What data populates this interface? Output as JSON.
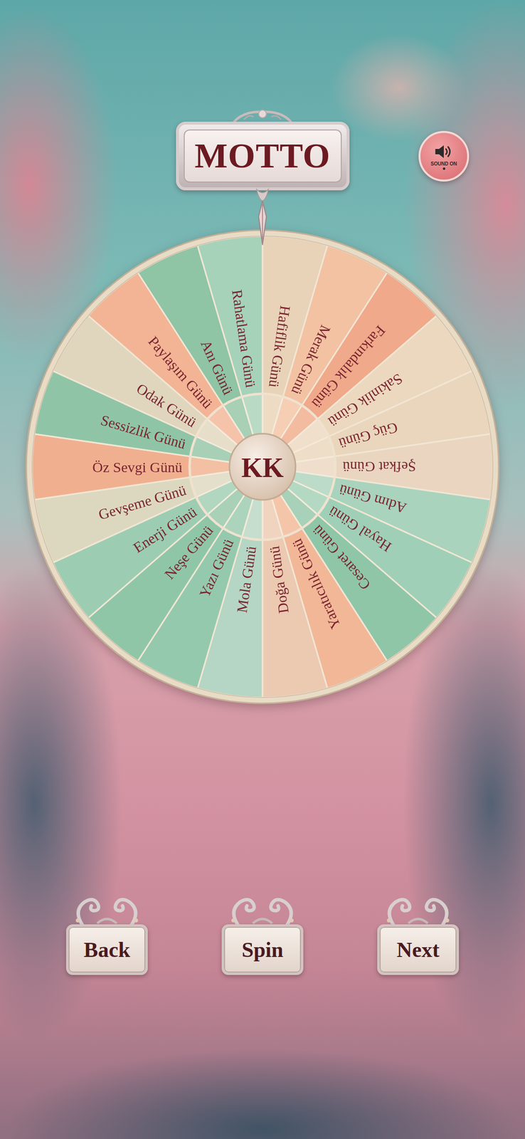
{
  "header": {
    "title": "MOTTO"
  },
  "sound": {
    "label": "SOUND ON",
    "on": true
  },
  "wheel": {
    "hub": "KK",
    "segments": [
      {
        "label": "Hafiflik Günü",
        "color": "#e8d3b8"
      },
      {
        "label": "Merak Günü",
        "color": "#f2c2a2"
      },
      {
        "label": "Farkındalık Günü",
        "color": "#f0a98a"
      },
      {
        "label": "Sakinlik Günü",
        "color": "#ecd8bf"
      },
      {
        "label": "Güç Günü",
        "color": "#e9d6bc"
      },
      {
        "label": "Şefkat Günü",
        "color": "#ead6c0"
      },
      {
        "label": "Adım Günü",
        "color": "#a9d3bd"
      },
      {
        "label": "Hayal Günü",
        "color": "#9fd0b7"
      },
      {
        "label": "Cesaret Günü",
        "color": "#8fc6a8"
      },
      {
        "label": "Yaratıcılık Günü",
        "color": "#f2b797"
      },
      {
        "label": "Doğa Günü",
        "color": "#ecc9b1"
      },
      {
        "label": "Mola Günü",
        "color": "#b5d6c4"
      },
      {
        "label": "Yazı Günü",
        "color": "#95c9ad"
      },
      {
        "label": "Neşe Günü",
        "color": "#90c6a8"
      },
      {
        "label": "Enerji Günü",
        "color": "#9ccdb2"
      },
      {
        "label": "Gevşeme Günü",
        "color": "#dcd8bf"
      },
      {
        "label": "Öz Sevgi Günü",
        "color": "#f0b08f"
      },
      {
        "label": "Sessizlik Günü",
        "color": "#8fc5a6"
      },
      {
        "label": "Odak Günü",
        "color": "#dfd6bd"
      },
      {
        "label": "Paylaşım Günü",
        "color": "#f2b495"
      },
      {
        "label": "Anı Günü",
        "color": "#8fc4a5"
      },
      {
        "label": "Rahatlama Günü",
        "color": "#a6d2ba"
      }
    ]
  },
  "buttons": [
    {
      "label": "Back"
    },
    {
      "label": "Spin"
    },
    {
      "label": "Next"
    }
  ]
}
